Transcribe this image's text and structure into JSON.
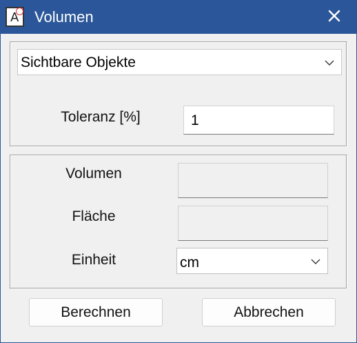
{
  "window": {
    "title": "Volumen",
    "app_icon_letter": "A"
  },
  "objects_select": {
    "value": "Sichtbare Objekte"
  },
  "tolerance": {
    "label": "Toleranz [%]",
    "value": "1"
  },
  "results": {
    "volume_label": "Volumen",
    "volume_value": "",
    "area_label": "Fläche",
    "area_value": ""
  },
  "unit": {
    "label": "Einheit",
    "value": "cm"
  },
  "buttons": {
    "calculate": "Berechnen",
    "cancel": "Abbrechen"
  },
  "colors": {
    "titlebar": "#2b579a",
    "dialog_bg": "#f0f0f0"
  },
  "icons": {
    "close": "close-icon",
    "dropdown": "chevron-down-icon",
    "app": "app-icon"
  }
}
